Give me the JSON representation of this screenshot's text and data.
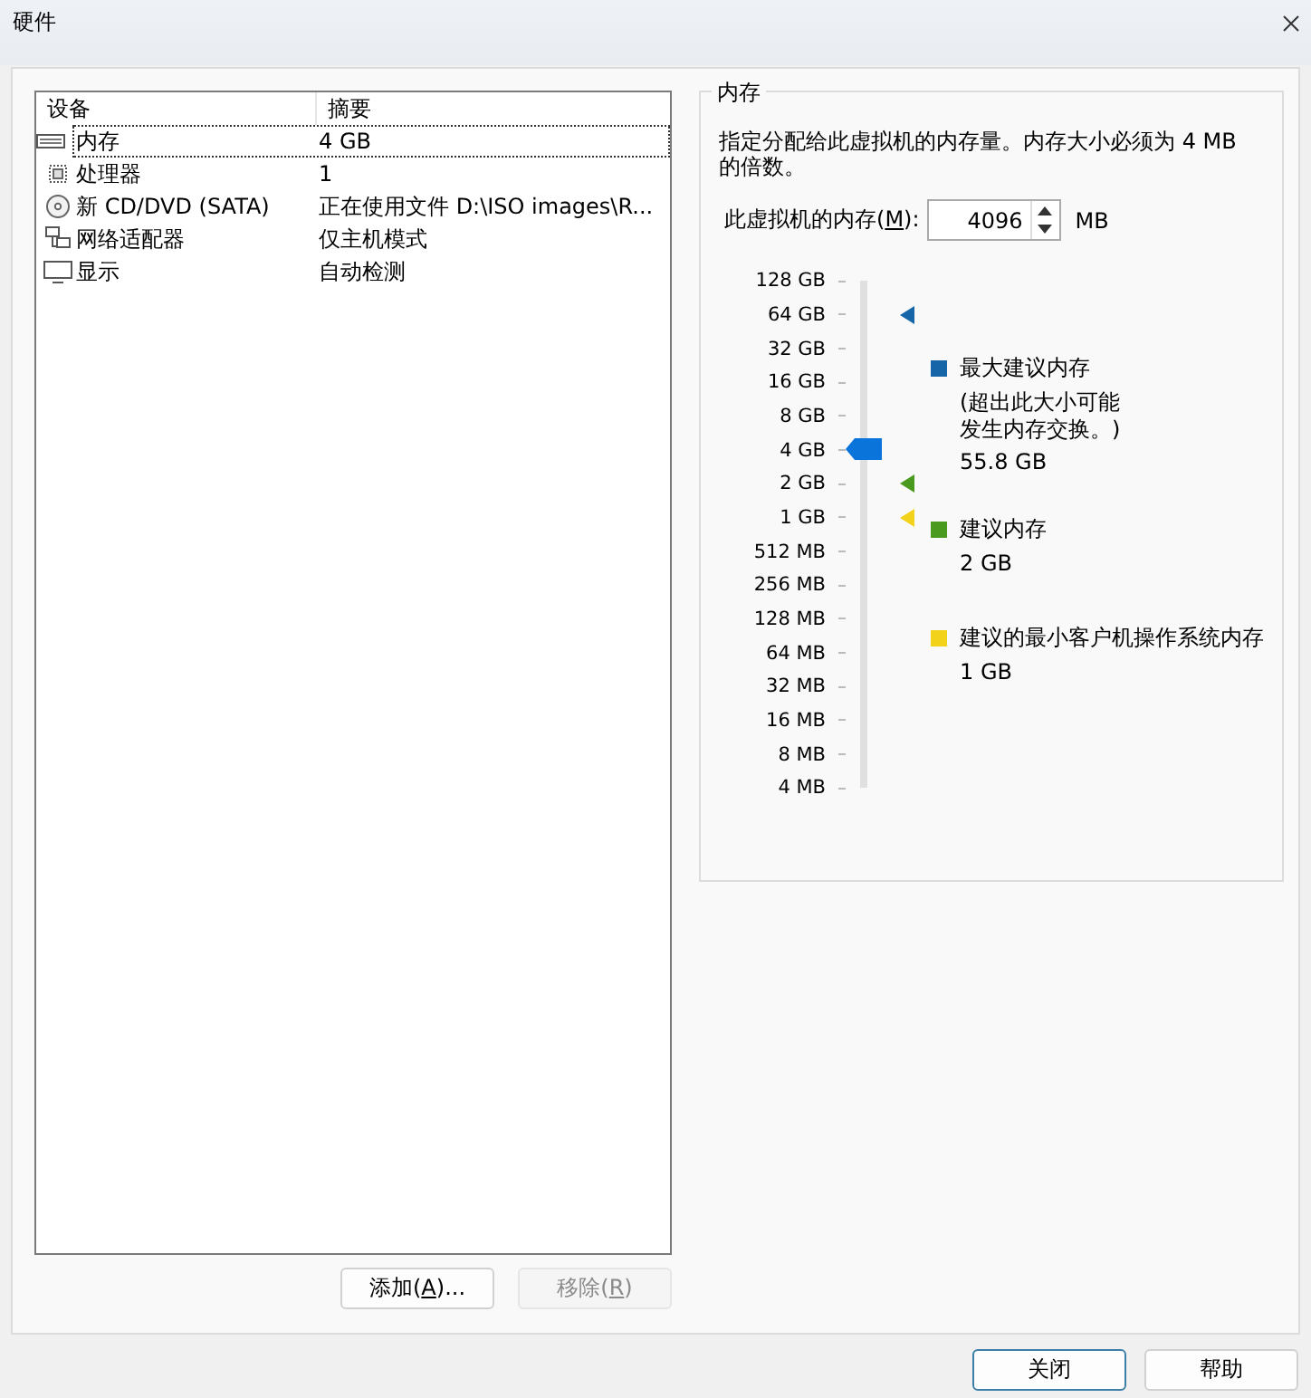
{
  "window": {
    "title": "硬件"
  },
  "device_list": {
    "columns": [
      "设备",
      "摘要"
    ],
    "rows": [
      {
        "kind": "memory",
        "device": "内存",
        "summary": "4 GB",
        "selected": true
      },
      {
        "kind": "cpu",
        "device": "处理器",
        "summary": "1",
        "selected": false
      },
      {
        "kind": "cd",
        "device": "新 CD/DVD (SATA)",
        "summary": "正在使用文件 D:\\ISO images\\R...",
        "selected": false
      },
      {
        "kind": "network",
        "device": "网络适配器",
        "summary": "仅主机模式",
        "selected": false
      },
      {
        "kind": "display",
        "device": "显示",
        "summary": "自动检测",
        "selected": false
      }
    ]
  },
  "list_buttons": [
    {
      "before": "添加(",
      "accel": "A",
      "after": ")...",
      "disabled": false
    },
    {
      "before": "移除(",
      "accel": "R",
      "after": ")",
      "disabled": true
    }
  ],
  "memory_panel": {
    "title": "内存",
    "description": "指定分配给此虚拟机的内存量。内存大小必须为 4 MB 的倍数。",
    "field_label": {
      "before": "此虚拟机的内存(",
      "accel": "M",
      "after": "):"
    },
    "value": "4096",
    "unit": "MB",
    "scale": [
      "128 GB",
      "64 GB",
      "32 GB",
      "16 GB",
      "8 GB",
      "4 GB",
      "2 GB",
      "1 GB",
      "512 MB",
      "256 MB",
      "128 MB",
      "64 MB",
      "32 MB",
      "16 MB",
      "8 MB",
      "4 MB"
    ],
    "slider": {
      "level": 0.6667
    },
    "markers": [
      {
        "color": "#1565a8",
        "level": 0.9333
      },
      {
        "color": "#4a9a1f",
        "level": 0.6
      },
      {
        "color": "#f2d21b",
        "level": 0.5333
      }
    ],
    "legend": [
      {
        "color": "#1565a8",
        "label": "最大建议内存",
        "note": "(超出此大小可能发生内存交换。)",
        "value": "55.8 GB"
      },
      {
        "color": "#4a9a1f",
        "label": "建议内存",
        "value": "2 GB"
      },
      {
        "color": "#f2d21b",
        "label": "建议的最小客户机操作系统内存",
        "value": "1 GB"
      }
    ]
  },
  "dialog_buttons": [
    {
      "label": "关闭",
      "default": true
    },
    {
      "label": "帮助",
      "default": false
    }
  ]
}
